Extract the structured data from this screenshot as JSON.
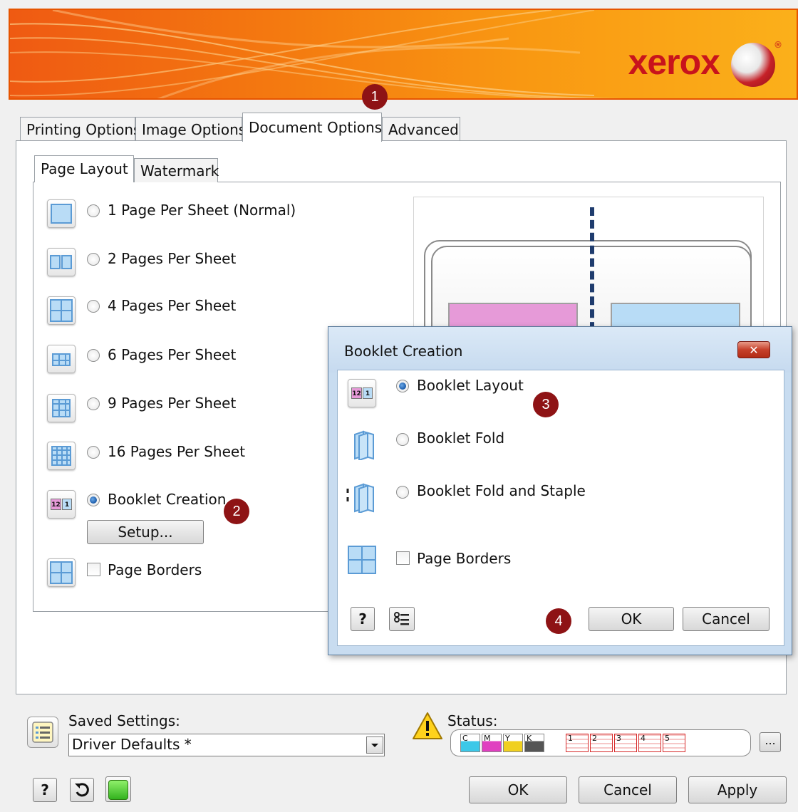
{
  "banner": {
    "logo_text": "xerox",
    "registered": "®"
  },
  "callouts": [
    "1",
    "2",
    "3",
    "4"
  ],
  "tabs": [
    {
      "label": "Printing Options"
    },
    {
      "label": "Image Options"
    },
    {
      "label": "Document Options"
    },
    {
      "label": "Advanced"
    }
  ],
  "subtabs": [
    {
      "label": "Page Layout"
    },
    {
      "label": "Watermark"
    }
  ],
  "layout_options": [
    {
      "label": "1 Page Per Sheet (Normal)",
      "selected": false
    },
    {
      "label": "2 Pages Per Sheet",
      "selected": false
    },
    {
      "label": "4 Pages Per Sheet",
      "selected": false
    },
    {
      "label": "6 Pages Per Sheet",
      "selected": false
    },
    {
      "label": "9 Pages Per Sheet",
      "selected": false
    },
    {
      "label": "16 Pages Per Sheet",
      "selected": false
    },
    {
      "label": "Booklet Creation",
      "selected": true
    }
  ],
  "setup_button": "Setup...",
  "page_borders_label": "Page Borders",
  "booklet_icon_text": {
    "left": "12",
    "right": "1"
  },
  "dialog": {
    "title": "Booklet Creation",
    "close_glyph": "✕",
    "options": [
      {
        "label": "Booklet Layout",
        "selected": true
      },
      {
        "label": "Booklet Fold",
        "selected": false
      },
      {
        "label": "Booklet Fold and Staple",
        "selected": false
      }
    ],
    "page_borders_label": "Page Borders",
    "help_label": "?",
    "ok_label": "OK",
    "cancel_label": "Cancel"
  },
  "saved_settings": {
    "label": "Saved Settings:",
    "value": "Driver Defaults *"
  },
  "status": {
    "label": "Status:",
    "toners": [
      "C",
      "M",
      "Y",
      "K"
    ],
    "toner_colors": [
      "#3cc8e8",
      "#e040c0",
      "#f0d020",
      "#555555"
    ],
    "trays": [
      "1",
      "2",
      "3",
      "4",
      "5"
    ],
    "more_label": "..."
  },
  "bottom": {
    "help_label": "?",
    "ok_label": "OK",
    "cancel_label": "Cancel",
    "apply_label": "Apply"
  },
  "colors": {
    "accent_orange": "#f47a10",
    "callout_red": "#8e1315",
    "xerox_red": "#c8141c"
  }
}
